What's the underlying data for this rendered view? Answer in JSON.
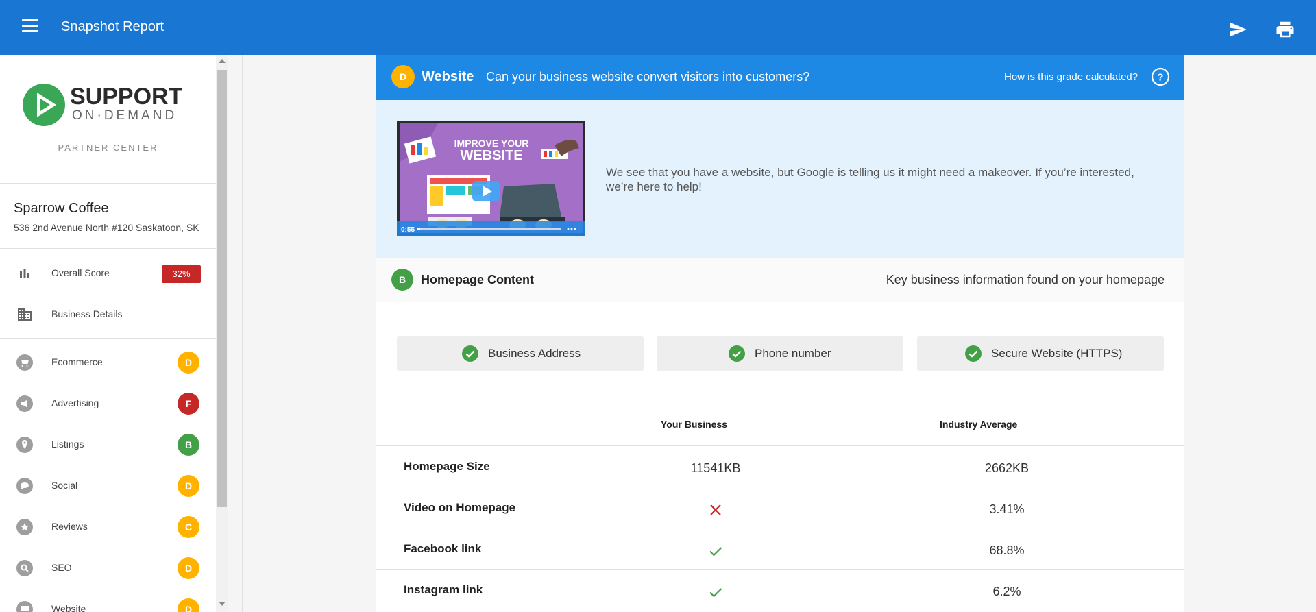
{
  "app": {
    "title": "Snapshot Report"
  },
  "sidebar": {
    "logo": {
      "line1": "SUPPORT",
      "line2": "ON·DEMAND"
    },
    "partner_label": "PARTNER CENTER",
    "business": {
      "name": "Sparrow Coffee",
      "address": "536 2nd Avenue North #120 Saskatoon, SK"
    },
    "overview": [
      {
        "label": "Overall Score",
        "icon": "bar-chart-icon",
        "badge": "32%"
      },
      {
        "label": "Business Details",
        "icon": "building-icon"
      }
    ],
    "sections": [
      {
        "label": "Ecommerce",
        "icon": "cart-icon",
        "grade": "D"
      },
      {
        "label": "Advertising",
        "icon": "megaphone-icon",
        "grade": "F"
      },
      {
        "label": "Listings",
        "icon": "location-pin-icon",
        "grade": "B"
      },
      {
        "label": "Social",
        "icon": "chat-bubble-icon",
        "grade": "D"
      },
      {
        "label": "Reviews",
        "icon": "star-icon",
        "grade": "C"
      },
      {
        "label": "SEO",
        "icon": "magnifier-icon",
        "grade": "D"
      },
      {
        "label": "Website",
        "icon": "monitor-icon",
        "grade": "D"
      }
    ]
  },
  "website_section": {
    "grade": "D",
    "title": "Website",
    "question": "Can your business website convert visitors into customers?",
    "grade_link": "How is this grade calculated?",
    "video": {
      "title_line1": "IMPROVE YOUR",
      "title_line2": "WEBSITE",
      "time": "0:55",
      "progress": 0.02
    },
    "description": "We see that you have a website, but Google is telling us it might need a makeover. If you’re interested, we’re here to help!"
  },
  "homepage_content": {
    "grade": "B",
    "title": "Homepage Content",
    "subtitle": "Key business information found on your homepage",
    "checks": [
      "Business Address",
      "Phone number",
      "Secure Website (HTTPS)"
    ],
    "columns": [
      "Your Business",
      "Industry Average"
    ],
    "rows": [
      {
        "metric": "Homepage Size",
        "yours": "11541KB",
        "average": "2662KB"
      },
      {
        "metric": "Video on Homepage",
        "yours_status": "no",
        "average": "3.41%"
      },
      {
        "metric": "Facebook link",
        "yours_status": "yes",
        "average": "68.8%"
      },
      {
        "metric": "Instagram link",
        "yours_status": "yes",
        "average": "6.2%"
      }
    ]
  },
  "colors": {
    "topbar": "#1976d2",
    "section_header": "#1e88e5",
    "grade_D": "#ffb300",
    "grade_F": "#c62828",
    "grade_B": "#43a047",
    "check_green": "#43a047",
    "cross_red": "#c62828"
  }
}
